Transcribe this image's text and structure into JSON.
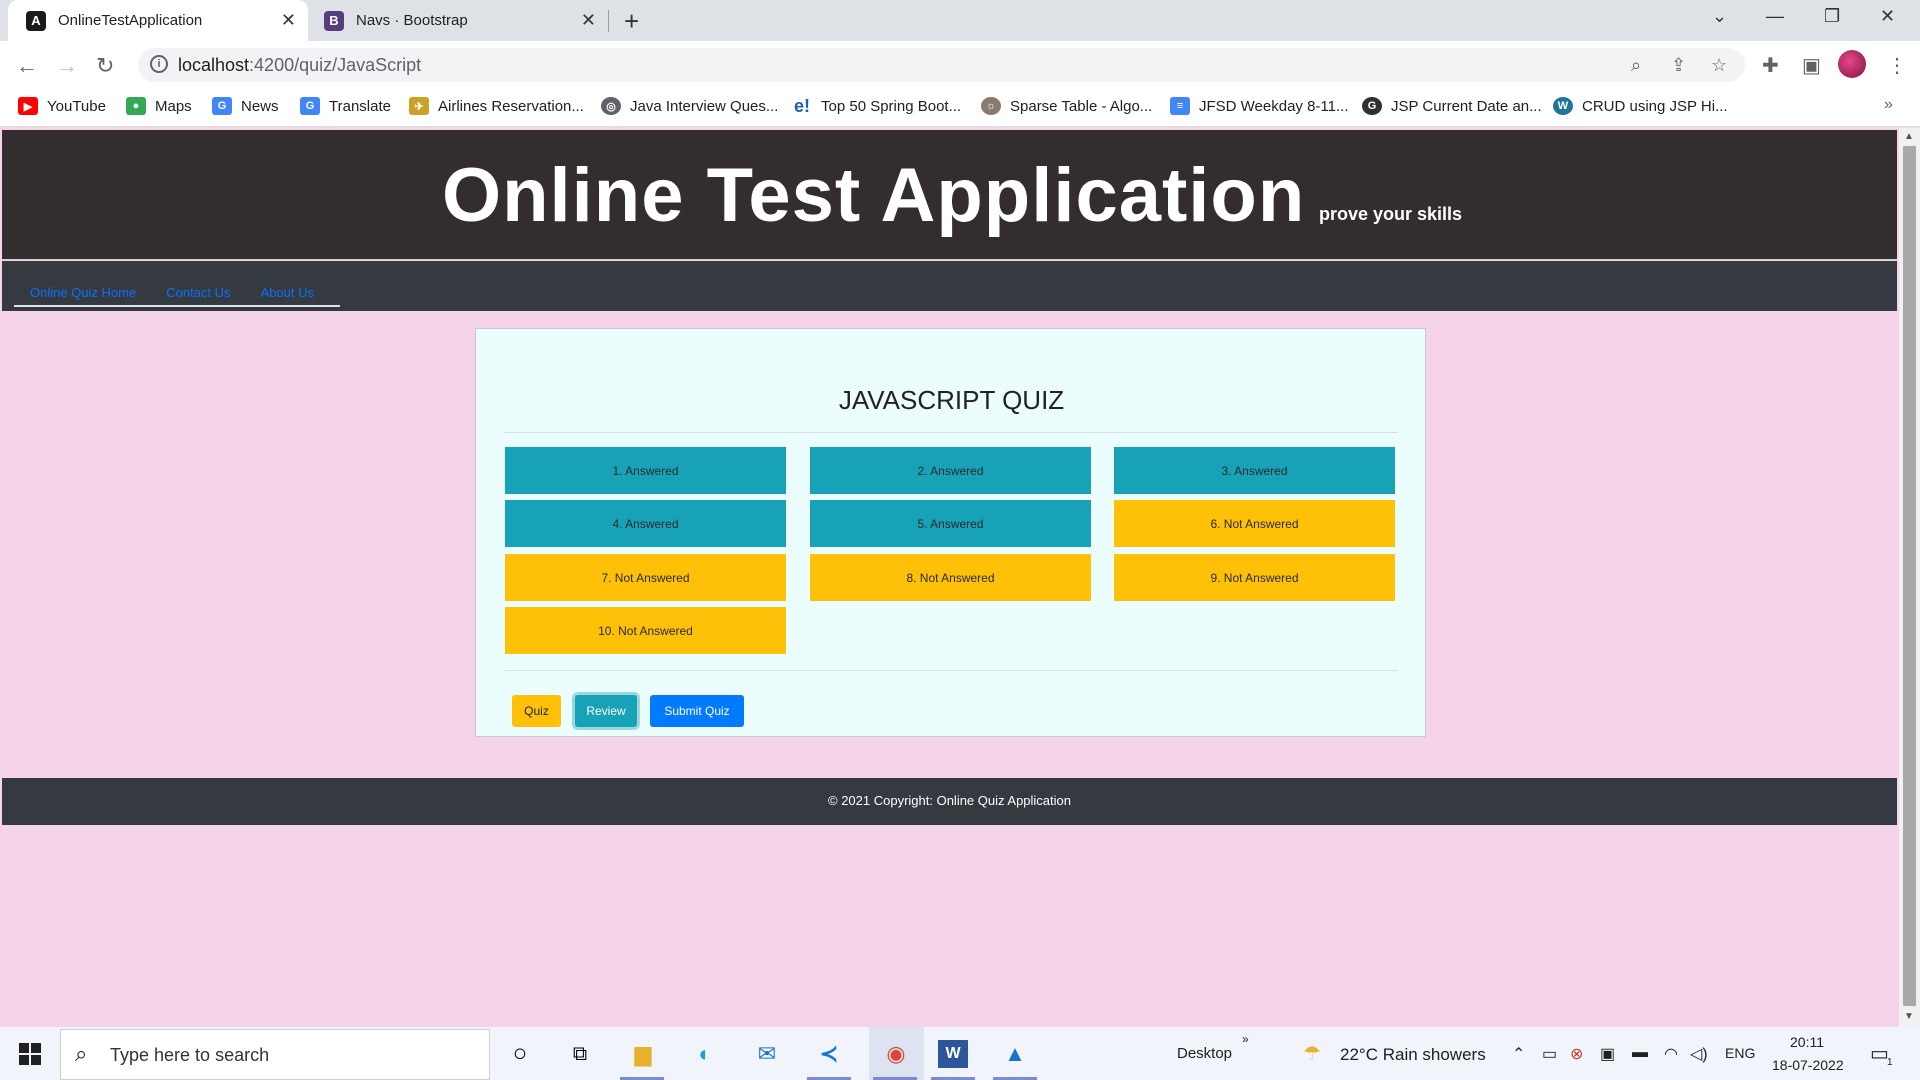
{
  "browser": {
    "tabs": [
      {
        "title": "OnlineTestApplication",
        "icon": "angular-icon"
      },
      {
        "title": "Navs · Bootstrap",
        "icon": "bootstrap-icon"
      }
    ],
    "url_host": "localhost",
    "url_rest": ":4200/quiz/JavaScript",
    "bookmarks": [
      {
        "label": "YouTube",
        "icon": "youtube-icon",
        "color": "#ff0000"
      },
      {
        "label": "Maps",
        "icon": "maps-icon",
        "color": "#34a853"
      },
      {
        "label": "News",
        "icon": "news-icon",
        "color": "#4285f4"
      },
      {
        "label": "Translate",
        "icon": "translate-icon",
        "color": "#4285f4"
      },
      {
        "label": "Airlines Reservation...",
        "icon": "airline-icon",
        "color": "#c9a227"
      },
      {
        "label": "Java Interview Ques...",
        "icon": "globe-icon",
        "color": "#5f6368"
      },
      {
        "label": "Top 50 Spring Boot...",
        "icon": "edureka-icon",
        "color": "#1d5fa8"
      },
      {
        "label": "Sparse Table - Algo...",
        "icon": "algo-icon",
        "color": "#8a7a6a"
      },
      {
        "label": "JFSD Weekday 8-11...",
        "icon": "docs-icon",
        "color": "#4285f4"
      },
      {
        "label": "JSP Current Date an...",
        "icon": "site-icon",
        "color": "#303030"
      },
      {
        "label": "CRUD using JSP Hi...",
        "icon": "wordpress-icon",
        "color": "#21759b"
      }
    ]
  },
  "header": {
    "title": "Online Test Application",
    "tagline": "prove your skills"
  },
  "nav": {
    "items": [
      "Online Quiz Home",
      "Contact Us",
      "About Us"
    ]
  },
  "quiz": {
    "title": "JAVASCRIPT QUIZ",
    "questions": [
      {
        "label": "1. Answered",
        "status": "answered"
      },
      {
        "label": "2. Answered",
        "status": "answered"
      },
      {
        "label": "3. Answered",
        "status": "answered"
      },
      {
        "label": "4. Answered",
        "status": "answered"
      },
      {
        "label": "5. Answered",
        "status": "answered"
      },
      {
        "label": "6. Not Answered",
        "status": "not"
      },
      {
        "label": "7. Not Answered",
        "status": "not"
      },
      {
        "label": "8. Not Answered",
        "status": "not"
      },
      {
        "label": "9. Not Answered",
        "status": "not"
      },
      {
        "label": "10. Not Answered",
        "status": "not"
      }
    ],
    "actions": {
      "quiz": "Quiz",
      "review": "Review",
      "submit": "Submit Quiz"
    },
    "colors": {
      "answered": "#17a2b8",
      "not_answered": "#ffc107",
      "submit": "#007bff"
    }
  },
  "footer": {
    "text": "© 2021 Copyright: Online Quiz Application"
  },
  "taskbar": {
    "search_placeholder": "Type here to search",
    "desktop_label": "Desktop",
    "weather": "22°C  Rain showers",
    "lang": "ENG",
    "time": "20:11",
    "date": "18-07-2022",
    "notification_count": "1"
  }
}
